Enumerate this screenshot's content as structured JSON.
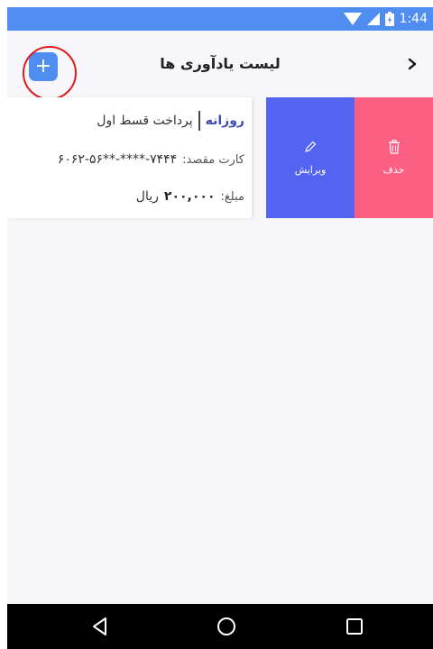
{
  "status_bar": {
    "time": "1:44",
    "icons": [
      "wifi-icon",
      "signal-icon",
      "battery-icon"
    ],
    "background": "#4f8df1"
  },
  "header": {
    "title": "لیست یادآوری ها",
    "add_button_label": "+",
    "back_icon": "chevron-right-icon",
    "add_button_color": "#4f8df1"
  },
  "reminders": [
    {
      "frequency": "روزانه",
      "title": "پرداخت قسط اول",
      "card_label": "کارت مقصد:",
      "card_number": "۶۰۶۲-۵۶**-****-۷۴۴۴",
      "amount_label": "مبلغ:",
      "amount_value": "۲۰۰,۰۰۰",
      "currency": "ریال",
      "actions": {
        "edit": {
          "label": "ویرایش",
          "icon": "pencil-icon",
          "color": "#5364f1"
        },
        "delete": {
          "label": "حذف",
          "icon": "trash-icon",
          "color": "#fd5e84"
        }
      }
    }
  ],
  "nav_bar": {
    "icons": [
      "back-triangle-icon",
      "home-circle-icon",
      "recents-square-icon"
    ]
  }
}
